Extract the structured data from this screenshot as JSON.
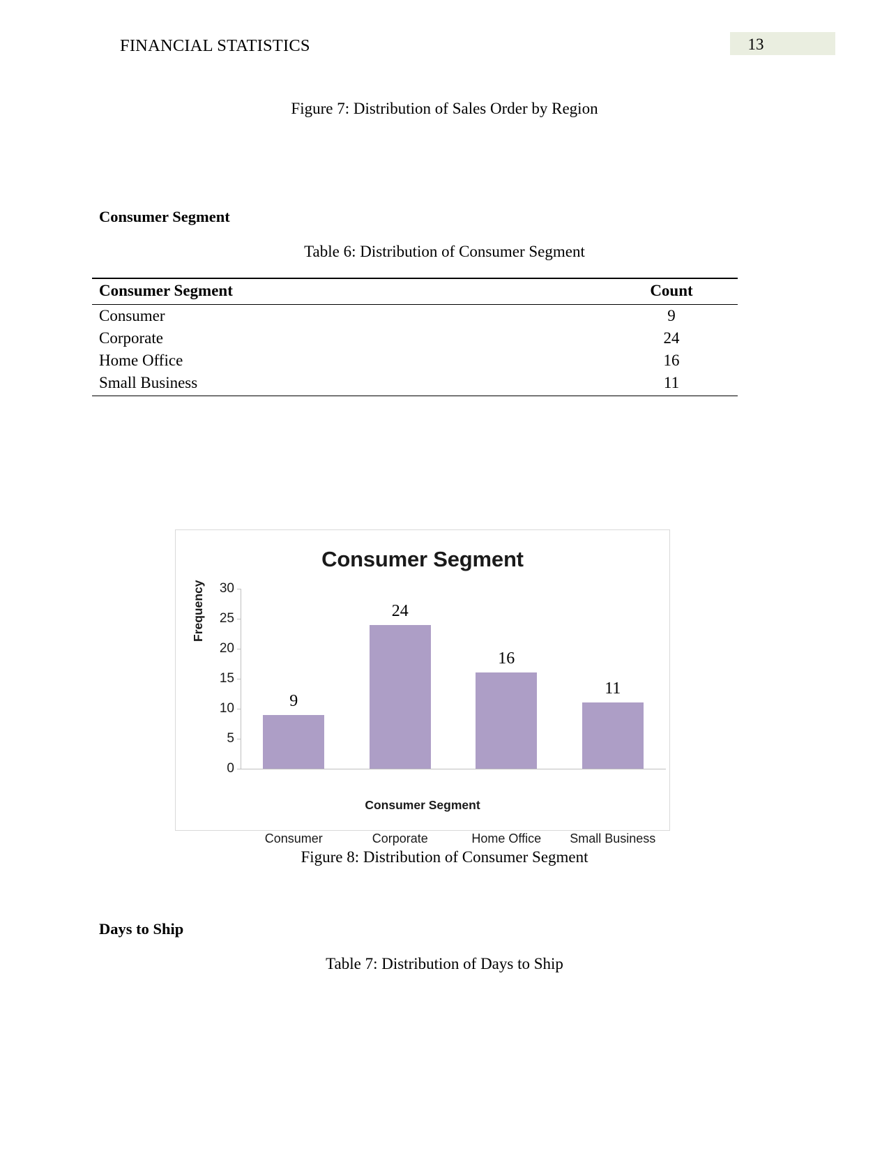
{
  "header": {
    "title": "FINANCIAL STATISTICS",
    "page_number": "13",
    "page_number_highlight": "#eaeee0"
  },
  "figure7_caption": "Figure 7: Distribution of Sales Order by Region",
  "section_consumer_segment": {
    "heading": "Consumer Segment",
    "table_caption": "Table 6: Distribution of Consumer Segment",
    "table": {
      "columns": [
        "Consumer Segment",
        "Count"
      ],
      "rows": [
        {
          "segment": "Consumer",
          "count": "9"
        },
        {
          "segment": "Corporate",
          "count": "24"
        },
        {
          "segment": "Home Office",
          "count": "16"
        },
        {
          "segment": "Small Business",
          "count": "11"
        }
      ]
    }
  },
  "figure8_caption": "Figure 8: Distribution of Consumer Segment",
  "section_days_to_ship": {
    "heading": "Days to Ship",
    "table_caption": "Table 7: Distribution of Days to Ship"
  },
  "chart_data": {
    "type": "bar",
    "title": "Consumer Segment",
    "xlabel": "Consumer Segment",
    "ylabel": "Frequency",
    "categories": [
      "Consumer",
      "Corporate",
      "Home Office",
      "Small Business"
    ],
    "values": [
      9,
      24,
      16,
      11
    ],
    "data_labels": [
      "9",
      "24",
      "16",
      "11"
    ],
    "ylim": [
      0,
      30
    ],
    "yticks": [
      0,
      5,
      10,
      15,
      20,
      25,
      30
    ],
    "ytick_labels": [
      "0",
      "5",
      "10",
      "15",
      "20",
      "25",
      "30"
    ],
    "grid": false,
    "legend": "none",
    "bar_color": "#ad9ec6",
    "axis_color": "#bfbfbf",
    "plot_background": "#ffffff"
  }
}
